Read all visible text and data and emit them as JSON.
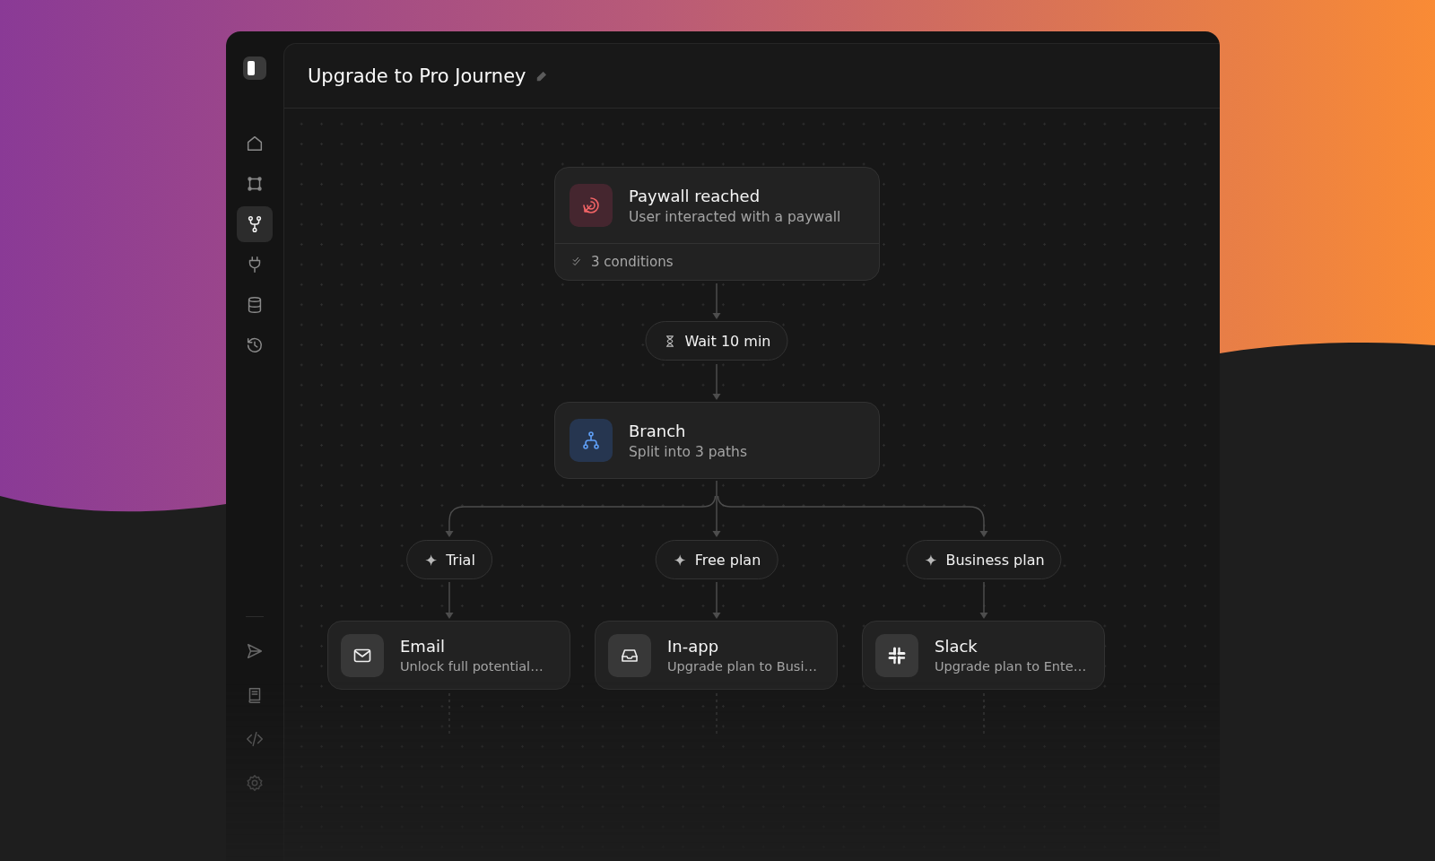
{
  "window": {
    "title": "Upgrade to Pro Journey"
  },
  "sidebar": {
    "top_items": [
      {
        "kind": "home",
        "selected": false
      },
      {
        "kind": "frame",
        "selected": false
      },
      {
        "kind": "flow",
        "selected": true
      },
      {
        "kind": "plug",
        "selected": false
      },
      {
        "kind": "database",
        "selected": false
      },
      {
        "kind": "history",
        "selected": false
      }
    ],
    "bottom_items": [
      {
        "kind": "send",
        "selected": false
      },
      {
        "kind": "book",
        "selected": false
      },
      {
        "kind": "code",
        "selected": false
      },
      {
        "kind": "gear",
        "selected": false
      }
    ]
  },
  "flow": {
    "trigger": {
      "kind": "trigger",
      "title": "Paywall reached",
      "subtitle": "User interacted with a paywall",
      "conditions": "3 conditions"
    },
    "wait": {
      "label": "Wait 10 min"
    },
    "branch": {
      "kind": "branch",
      "title": "Branch",
      "subtitle": "Split into 3 paths"
    },
    "paths": [
      {
        "label": "Trial",
        "action": {
          "kind": "email",
          "title": "Email",
          "subtitle": "Unlock full potential…"
        }
      },
      {
        "label": "Free plan",
        "action": {
          "kind": "inapp",
          "title": "In-app",
          "subtitle": "Upgrade plan to Busi…"
        }
      },
      {
        "label": "Business plan",
        "action": {
          "kind": "slack",
          "title": "Slack",
          "subtitle": "Upgrade plan to Ente…"
        }
      }
    ]
  }
}
